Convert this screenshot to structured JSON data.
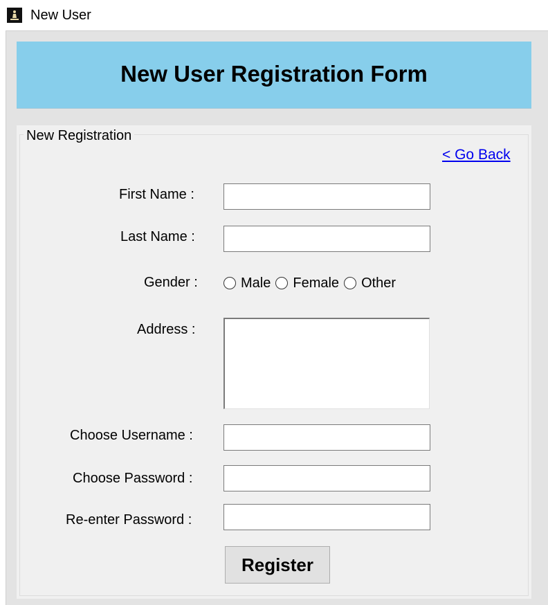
{
  "window": {
    "title": "New User",
    "icon": "app-icon"
  },
  "header": {
    "title": "New User Registration Form",
    "background_color": "#87ceeb"
  },
  "group": {
    "legend": "New Registration",
    "go_back_link": "< Go Back",
    "link_color": "#0000ee"
  },
  "form": {
    "first_name": {
      "label": "First Name :",
      "value": ""
    },
    "last_name": {
      "label": "Last Name :",
      "value": ""
    },
    "gender": {
      "label": "Gender :",
      "options": [
        "Male",
        "Female",
        "Other"
      ],
      "selected": null
    },
    "address": {
      "label": "Address :",
      "value": ""
    },
    "username": {
      "label": "Choose Username :",
      "value": ""
    },
    "password": {
      "label": "Choose Password :",
      "value": ""
    },
    "reenter_password": {
      "label": "Re-enter Password :",
      "value": ""
    },
    "submit_label": "Register"
  }
}
